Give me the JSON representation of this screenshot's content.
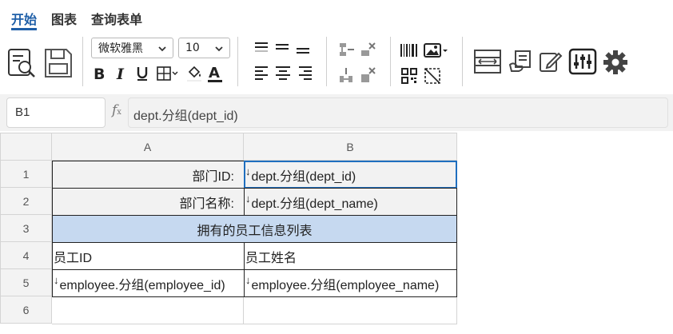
{
  "tabs": [
    {
      "label": "开始",
      "active": true
    },
    {
      "label": "图表",
      "active": false
    },
    {
      "label": "查询表单",
      "active": false
    }
  ],
  "toolbar": {
    "font_family": "微软雅黑",
    "font_size": "10"
  },
  "formula_bar": {
    "cell_ref": "B1",
    "fx_label": "f",
    "fx_sub": "x",
    "formula": "dept.分组(dept_id)"
  },
  "sheet": {
    "columns": [
      "A",
      "B"
    ],
    "rows": [
      "1",
      "2",
      "3",
      "4",
      "5",
      "6"
    ],
    "cells": {
      "A1": "部门ID:",
      "B1": "dept.分组(dept_id)",
      "A2": "部门名称:",
      "B2": "dept.分组(dept_name)",
      "A3": "拥有的员工信息列表",
      "A4": "员工ID",
      "B4": "员工姓名",
      "A5": "employee.分组(employee_id)",
      "B5": "employee.分组(employee_name)"
    },
    "expand_marker": "↓"
  },
  "colors": {
    "accent": "#1f5fa8",
    "header_bg": "#f3f3f3",
    "title_row_bg": "#c6d9f0",
    "selection": "#1f6fbf"
  }
}
